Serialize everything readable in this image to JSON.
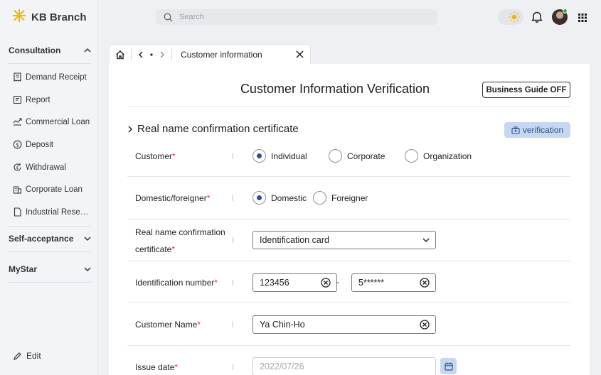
{
  "app": {
    "brand_name": "KB Branch"
  },
  "sidebar": {
    "sections": [
      {
        "label": "Consultation",
        "expanded": true
      },
      {
        "label": "Self-acceptance",
        "expanded": false
      },
      {
        "label": "MyStar",
        "expanded": false
      }
    ],
    "items": [
      {
        "label": "Demand Receipt",
        "icon": "receipt-icon"
      },
      {
        "label": "Report",
        "icon": "report-icon"
      },
      {
        "label": "Commercial Loan",
        "icon": "commercial-loan-icon"
      },
      {
        "label": "Deposit",
        "icon": "deposit-icon"
      },
      {
        "label": "Withdrawal",
        "icon": "withdrawal-icon"
      },
      {
        "label": "Corporate Loan",
        "icon": "building-icon"
      },
      {
        "label": "Industrial Rese…",
        "icon": "document-icon"
      }
    ],
    "edit_label": "Edit"
  },
  "topbar": {
    "search_placeholder": "Search"
  },
  "tabs": {
    "active_title": "Customer information"
  },
  "page": {
    "title": "Customer Information Verification",
    "guide_button": "Business Guide OFF",
    "section_title": "Real name confirmation certificate",
    "verify_button": "verification"
  },
  "form": {
    "customer": {
      "label": "Customer",
      "options": [
        "Individual",
        "Corporate",
        "Organization"
      ],
      "selected": "Individual"
    },
    "domestic": {
      "label": "Domestic/foreigner",
      "options": [
        "Domestic",
        "Foreigner"
      ],
      "selected": "Domestic"
    },
    "certificate": {
      "label_line1": "Real name confirmation",
      "label_line2": "certificate",
      "value": "Identification card"
    },
    "id_number": {
      "label": "Identification number",
      "part1": "123456",
      "separator": "-",
      "part2": "5******"
    },
    "customer_name": {
      "label": "Customer Name",
      "value": "Ya Chin-Ho"
    },
    "issue_date": {
      "label": "Issue date",
      "placeholder": "2022/07/26"
    },
    "required_mark": "*"
  },
  "colors": {
    "accent": "#2d4f9b",
    "button_light_blue": "#c5d8f2",
    "required": "#d33333",
    "brand_yellow": "#f2b705"
  }
}
